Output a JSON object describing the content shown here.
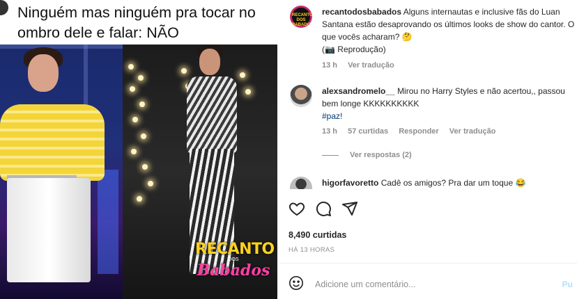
{
  "meme": {
    "caption": "Ninguém mas ninguém pra tocar no ombro dele e falar: NÃO",
    "watermark": {
      "top": "RECANTO",
      "middle": "DOS",
      "bottom": "Babados"
    }
  },
  "post": {
    "author_avatar_text": "RECANTO DOS BABADOS",
    "author": "recantodosbabados",
    "caption": "Alguns internautas e inclusive fãs do Luan Santana estão desaprovando os últimos looks de show do cantor. O que vocês acharam? 🤔",
    "credit": "(📷 Reprodução)",
    "time": "13 h",
    "translate": "Ver tradução"
  },
  "comments": [
    {
      "user": "alexsandromelo__",
      "text": "Mirou no Harry Styles e não acertou,, passou bem longe KKKKKKKKKK",
      "hashtag": "#paz!",
      "time": "13 h",
      "likes": "57 curtidas",
      "reply": "Responder",
      "translate": "Ver tradução",
      "view_replies": "Ver respostas (2)"
    },
    {
      "user": "higorfavoretto",
      "text": "Cadê os amigos? Pra dar um toque 😂"
    }
  ],
  "icons": {
    "like": "heart-icon",
    "comment": "comment-icon",
    "share": "share-icon",
    "emoji": "emoji-icon"
  },
  "stats": {
    "likes": "8,490 curtidas",
    "posted": "HÁ 13 HORAS"
  },
  "composer": {
    "placeholder": "Adicione um comentário...",
    "post_label": "Pu"
  },
  "colors": {
    "link": "#00376b",
    "muted": "#8e8e8e",
    "post_button": "#b2dffc"
  }
}
